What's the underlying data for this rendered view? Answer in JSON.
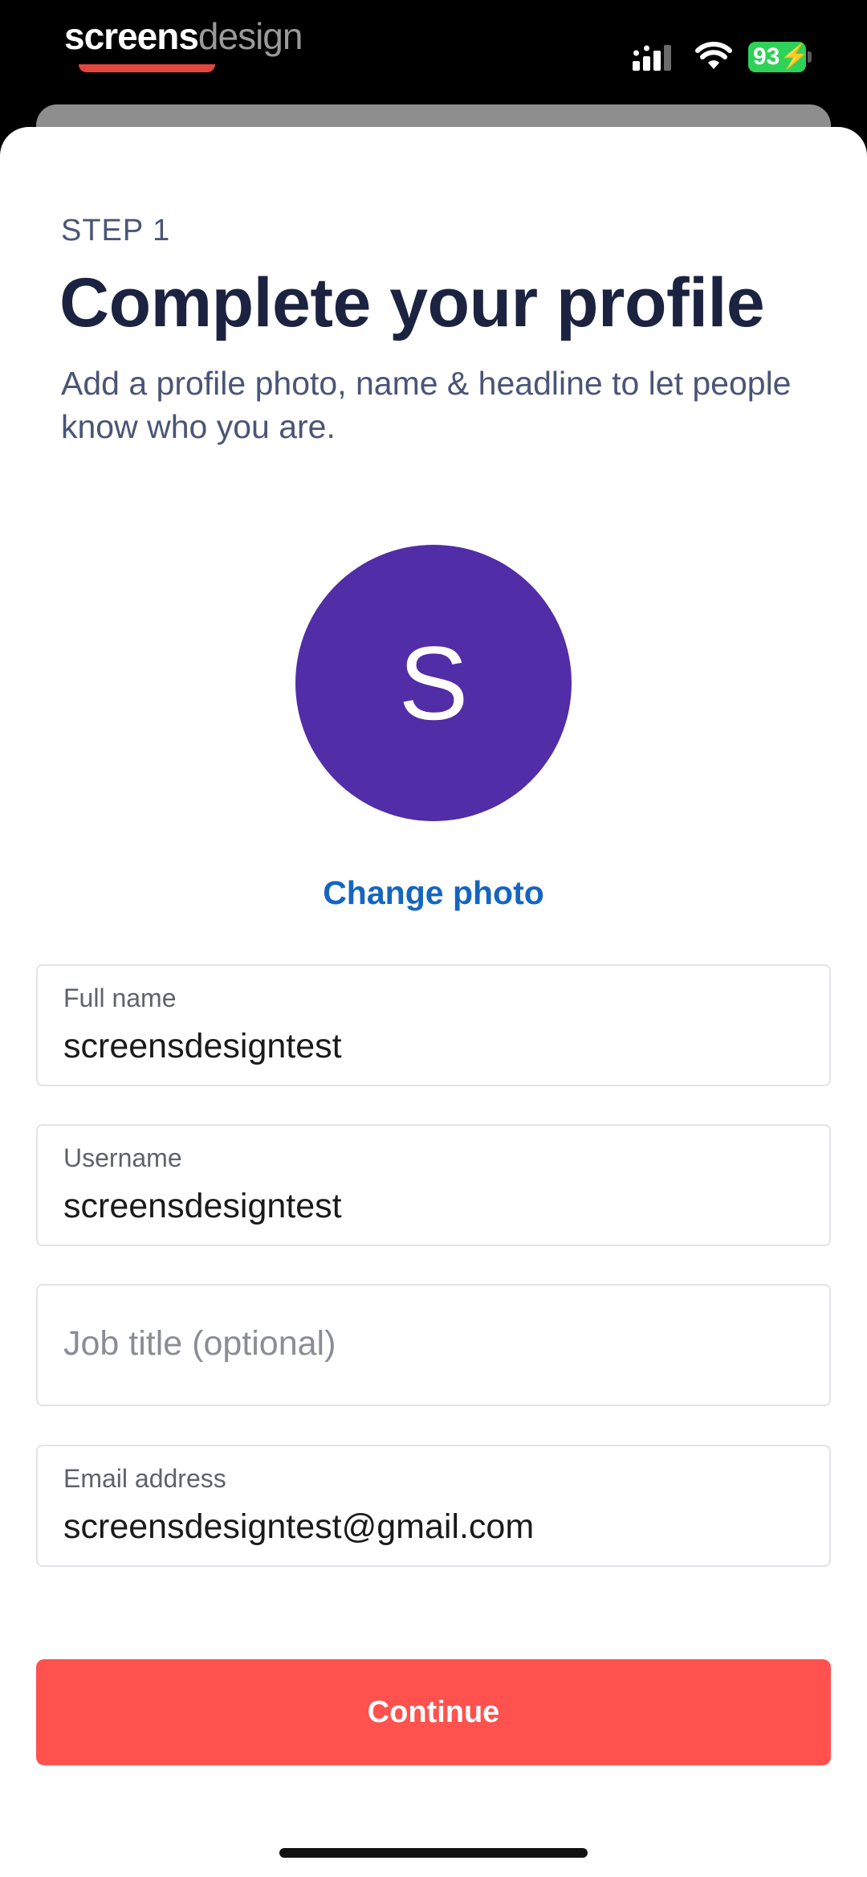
{
  "status_bar": {
    "brand_primary": "screens",
    "brand_secondary": "design",
    "battery": "93"
  },
  "header": {
    "step": "STEP 1",
    "title": "Complete your profile",
    "subtitle": "Add a profile photo, name & headline to let people know who you are."
  },
  "profile": {
    "avatar_initial": "S",
    "avatar_color": "#512da8",
    "change_photo_label": "Change photo"
  },
  "form": {
    "full_name": {
      "label": "Full name",
      "value": "screensdesigntest"
    },
    "username": {
      "label": "Username",
      "value": "screensdesigntest"
    },
    "job_title": {
      "placeholder": "Job title (optional)",
      "value": ""
    },
    "email": {
      "label": "Email address",
      "value": "screensdesigntest@gmail.com"
    }
  },
  "actions": {
    "continue_label": "Continue",
    "continue_color": "#ff514e"
  },
  "icons": {
    "signal": "cellular-signal-icon",
    "wifi": "wifi-icon",
    "battery": "battery-charging-icon"
  }
}
